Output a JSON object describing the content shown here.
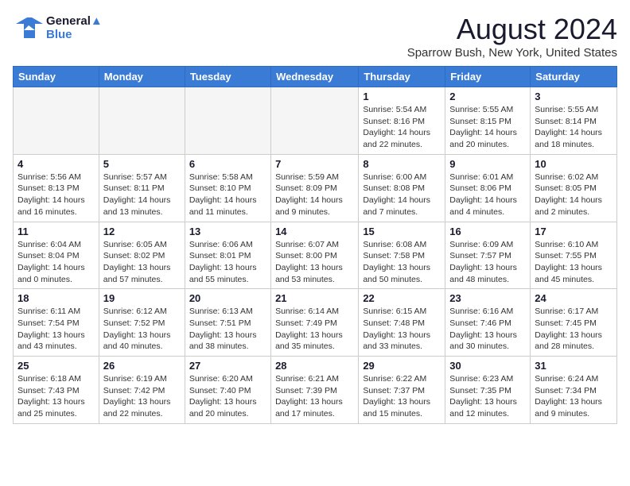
{
  "logo": {
    "part1": "General",
    "part2": "Blue"
  },
  "title": "August 2024",
  "location": "Sparrow Bush, New York, United States",
  "weekdays": [
    "Sunday",
    "Monday",
    "Tuesday",
    "Wednesday",
    "Thursday",
    "Friday",
    "Saturday"
  ],
  "weeks": [
    [
      {
        "day": "",
        "empty": true
      },
      {
        "day": "",
        "empty": true
      },
      {
        "day": "",
        "empty": true
      },
      {
        "day": "",
        "empty": true
      },
      {
        "day": "1",
        "info": "Sunrise: 5:54 AM\nSunset: 8:16 PM\nDaylight: 14 hours\nand 22 minutes."
      },
      {
        "day": "2",
        "info": "Sunrise: 5:55 AM\nSunset: 8:15 PM\nDaylight: 14 hours\nand 20 minutes."
      },
      {
        "day": "3",
        "info": "Sunrise: 5:55 AM\nSunset: 8:14 PM\nDaylight: 14 hours\nand 18 minutes."
      }
    ],
    [
      {
        "day": "4",
        "info": "Sunrise: 5:56 AM\nSunset: 8:13 PM\nDaylight: 14 hours\nand 16 minutes."
      },
      {
        "day": "5",
        "info": "Sunrise: 5:57 AM\nSunset: 8:11 PM\nDaylight: 14 hours\nand 13 minutes."
      },
      {
        "day": "6",
        "info": "Sunrise: 5:58 AM\nSunset: 8:10 PM\nDaylight: 14 hours\nand 11 minutes."
      },
      {
        "day": "7",
        "info": "Sunrise: 5:59 AM\nSunset: 8:09 PM\nDaylight: 14 hours\nand 9 minutes."
      },
      {
        "day": "8",
        "info": "Sunrise: 6:00 AM\nSunset: 8:08 PM\nDaylight: 14 hours\nand 7 minutes."
      },
      {
        "day": "9",
        "info": "Sunrise: 6:01 AM\nSunset: 8:06 PM\nDaylight: 14 hours\nand 4 minutes."
      },
      {
        "day": "10",
        "info": "Sunrise: 6:02 AM\nSunset: 8:05 PM\nDaylight: 14 hours\nand 2 minutes."
      }
    ],
    [
      {
        "day": "11",
        "info": "Sunrise: 6:04 AM\nSunset: 8:04 PM\nDaylight: 14 hours\nand 0 minutes."
      },
      {
        "day": "12",
        "info": "Sunrise: 6:05 AM\nSunset: 8:02 PM\nDaylight: 13 hours\nand 57 minutes."
      },
      {
        "day": "13",
        "info": "Sunrise: 6:06 AM\nSunset: 8:01 PM\nDaylight: 13 hours\nand 55 minutes."
      },
      {
        "day": "14",
        "info": "Sunrise: 6:07 AM\nSunset: 8:00 PM\nDaylight: 13 hours\nand 53 minutes."
      },
      {
        "day": "15",
        "info": "Sunrise: 6:08 AM\nSunset: 7:58 PM\nDaylight: 13 hours\nand 50 minutes."
      },
      {
        "day": "16",
        "info": "Sunrise: 6:09 AM\nSunset: 7:57 PM\nDaylight: 13 hours\nand 48 minutes."
      },
      {
        "day": "17",
        "info": "Sunrise: 6:10 AM\nSunset: 7:55 PM\nDaylight: 13 hours\nand 45 minutes."
      }
    ],
    [
      {
        "day": "18",
        "info": "Sunrise: 6:11 AM\nSunset: 7:54 PM\nDaylight: 13 hours\nand 43 minutes."
      },
      {
        "day": "19",
        "info": "Sunrise: 6:12 AM\nSunset: 7:52 PM\nDaylight: 13 hours\nand 40 minutes."
      },
      {
        "day": "20",
        "info": "Sunrise: 6:13 AM\nSunset: 7:51 PM\nDaylight: 13 hours\nand 38 minutes."
      },
      {
        "day": "21",
        "info": "Sunrise: 6:14 AM\nSunset: 7:49 PM\nDaylight: 13 hours\nand 35 minutes."
      },
      {
        "day": "22",
        "info": "Sunrise: 6:15 AM\nSunset: 7:48 PM\nDaylight: 13 hours\nand 33 minutes."
      },
      {
        "day": "23",
        "info": "Sunrise: 6:16 AM\nSunset: 7:46 PM\nDaylight: 13 hours\nand 30 minutes."
      },
      {
        "day": "24",
        "info": "Sunrise: 6:17 AM\nSunset: 7:45 PM\nDaylight: 13 hours\nand 28 minutes."
      }
    ],
    [
      {
        "day": "25",
        "info": "Sunrise: 6:18 AM\nSunset: 7:43 PM\nDaylight: 13 hours\nand 25 minutes."
      },
      {
        "day": "26",
        "info": "Sunrise: 6:19 AM\nSunset: 7:42 PM\nDaylight: 13 hours\nand 22 minutes."
      },
      {
        "day": "27",
        "info": "Sunrise: 6:20 AM\nSunset: 7:40 PM\nDaylight: 13 hours\nand 20 minutes."
      },
      {
        "day": "28",
        "info": "Sunrise: 6:21 AM\nSunset: 7:39 PM\nDaylight: 13 hours\nand 17 minutes."
      },
      {
        "day": "29",
        "info": "Sunrise: 6:22 AM\nSunset: 7:37 PM\nDaylight: 13 hours\nand 15 minutes."
      },
      {
        "day": "30",
        "info": "Sunrise: 6:23 AM\nSunset: 7:35 PM\nDaylight: 13 hours\nand 12 minutes."
      },
      {
        "day": "31",
        "info": "Sunrise: 6:24 AM\nSunset: 7:34 PM\nDaylight: 13 hours\nand 9 minutes."
      }
    ]
  ]
}
